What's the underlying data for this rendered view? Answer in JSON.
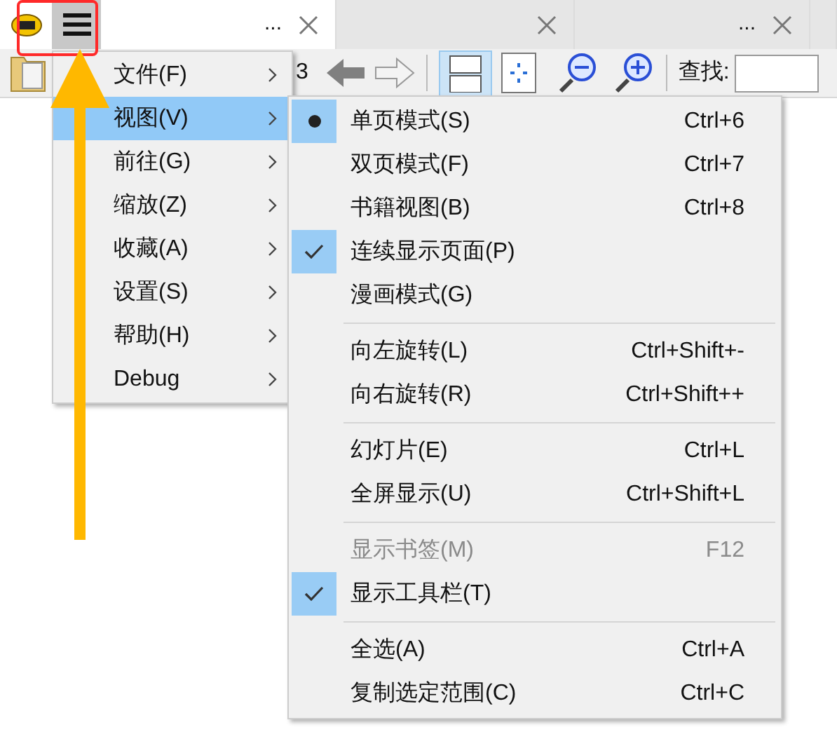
{
  "tabs": [
    {
      "title": "...",
      "selected": true
    },
    {
      "selected": false
    },
    {
      "title": "...",
      "selected": false
    },
    {
      "selected": false
    }
  ],
  "toolbar": {
    "page_number": "3",
    "find_label": "查找:"
  },
  "main_menu": [
    {
      "label": "文件(F)",
      "selected": false
    },
    {
      "label": "视图(V)",
      "selected": true
    },
    {
      "label": "前往(G)",
      "selected": false
    },
    {
      "label": "缩放(Z)",
      "selected": false
    },
    {
      "label": "收藏(A)",
      "selected": false
    },
    {
      "label": "设置(S)",
      "selected": false
    },
    {
      "label": "帮助(H)",
      "selected": false
    },
    {
      "label": "Debug",
      "selected": false
    }
  ],
  "view_submenu": [
    [
      {
        "label": "单页模式(S)",
        "shortcut": "Ctrl+6",
        "selected": true,
        "disabled": false
      },
      {
        "label": "双页模式(F)",
        "shortcut": "Ctrl+7",
        "selected": false,
        "disabled": false
      },
      {
        "label": "书籍视图(B)",
        "shortcut": "Ctrl+8",
        "selected": false,
        "disabled": false
      },
      {
        "label": "连续显示页面(P)",
        "checked": true,
        "disabled": false
      },
      {
        "label": "漫画模式(G)",
        "checked": false,
        "disabled": false
      }
    ],
    [
      {
        "label": "向左旋转(L)",
        "shortcut": "Ctrl+Shift+-",
        "disabled": false
      },
      {
        "label": "向右旋转(R)",
        "shortcut": "Ctrl+Shift++",
        "disabled": false
      }
    ],
    [
      {
        "label": "幻灯片(E)",
        "shortcut": "Ctrl+L",
        "disabled": false
      },
      {
        "label": "全屏显示(U)",
        "shortcut": "Ctrl+Shift+L",
        "disabled": false
      }
    ],
    [
      {
        "label": "显示书签(M)",
        "shortcut": "F12",
        "checked": false,
        "disabled": true
      },
      {
        "label": "显示工具栏(T)",
        "checked": true,
        "disabled": false
      }
    ],
    [
      {
        "label": "全选(A)",
        "shortcut": "Ctrl+A",
        "disabled": false
      },
      {
        "label": "复制选定范围(C)",
        "shortcut": "Ctrl+C",
        "disabled": false
      }
    ]
  ]
}
